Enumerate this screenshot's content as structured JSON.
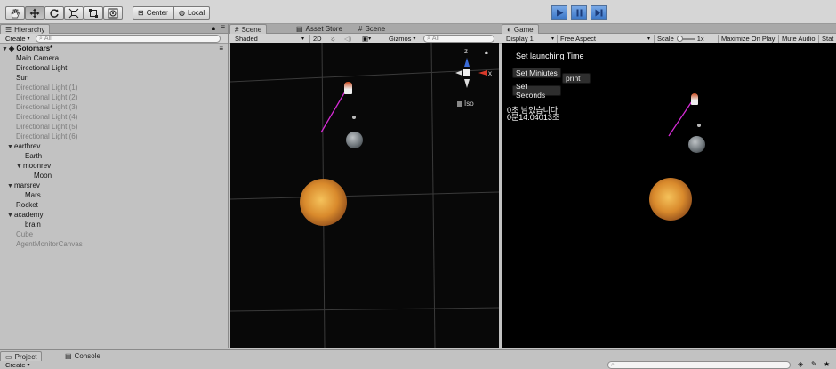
{
  "toolbar": {
    "tools": [
      "hand-tool",
      "move-tool",
      "rotate-tool",
      "scale-tool",
      "rect-tool",
      "transform-tool"
    ],
    "pivot_label": "Center",
    "space_label": "Local",
    "accent_color": "#3d78c8"
  },
  "hierarchy": {
    "tab_label": "Hierarchy",
    "create_label": "Create",
    "search_placeholder": "All",
    "scene_name": "Gotomars*",
    "items": [
      {
        "label": "Main Camera",
        "active": true
      },
      {
        "label": "Directional Light",
        "active": true
      },
      {
        "label": "Sun",
        "active": true
      },
      {
        "label": "Directional Light (1)",
        "active": false
      },
      {
        "label": "Directional Light (2)",
        "active": false
      },
      {
        "label": "Directional Light (3)",
        "active": false
      },
      {
        "label": "Directional Light (4)",
        "active": false
      },
      {
        "label": "Directional Light (5)",
        "active": false
      },
      {
        "label": "Directional Light (6)",
        "active": false
      },
      {
        "label": "earthrev",
        "active": true
      },
      {
        "label": "Earth",
        "active": true
      },
      {
        "label": "moonrev",
        "active": true
      },
      {
        "label": "Moon",
        "active": true
      },
      {
        "label": "marsrev",
        "active": true
      },
      {
        "label": "Mars",
        "active": true
      },
      {
        "label": "Rocket",
        "active": true
      },
      {
        "label": "academy",
        "active": true
      },
      {
        "label": "brain",
        "active": true
      },
      {
        "label": "Cube",
        "active": false
      },
      {
        "label": "AgentMonitorCanvas",
        "active": false
      }
    ]
  },
  "scene": {
    "tabs": [
      "Scene",
      "Asset Store",
      "Scene"
    ],
    "shading": "Shaded",
    "mode_2d": "2D",
    "gizmos": "Gizmos",
    "search_placeholder": "All",
    "iso_label": "Iso",
    "axis_z": "z",
    "axis_x": "x"
  },
  "game": {
    "tab_label": "Game",
    "display": "Display 1",
    "aspect": "Free Aspect",
    "scale_label": "Scale",
    "scale_value": "1x",
    "maximize": "Maximize On Play",
    "mute": "Mute Audio",
    "stats": "Stat",
    "launch_title": "Set launching Time",
    "btn_minutes": "Set Miniutes",
    "btn_print": "print",
    "btn_seconds": "Set Seconds",
    "msg_line1": "0초 남았습니다",
    "msg_line2": "0분14.04013초"
  },
  "bottom": {
    "project_tab": "Project",
    "console_tab": "Console",
    "create_label": "Create"
  }
}
